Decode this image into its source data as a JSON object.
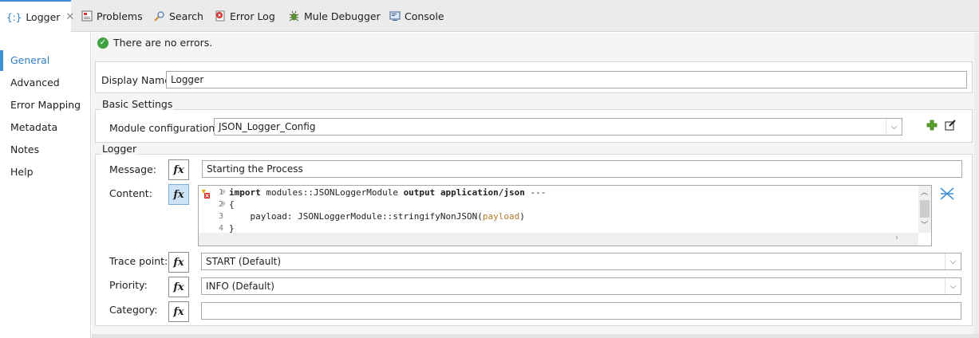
{
  "tabs": [
    {
      "label": "Logger",
      "icon": "logger-icon"
    },
    {
      "label": "Problems",
      "icon": "problems-icon"
    },
    {
      "label": "Search",
      "icon": "search-icon"
    },
    {
      "label": "Error Log",
      "icon": "error-log-icon"
    },
    {
      "label": "Mule Debugger",
      "icon": "debugger-icon"
    },
    {
      "label": "Console",
      "icon": "console-icon"
    }
  ],
  "logger_tab_glyph": "{:}",
  "sidebar": {
    "items": [
      {
        "label": "General",
        "active": true
      },
      {
        "label": "Advanced"
      },
      {
        "label": "Error Mapping"
      },
      {
        "label": "Metadata"
      },
      {
        "label": "Notes"
      },
      {
        "label": "Help"
      }
    ]
  },
  "status": {
    "text": "There are no errors."
  },
  "display_name": {
    "label": "Display Name:",
    "value": "Logger"
  },
  "basic_settings": {
    "title": "Basic Settings",
    "module_label": "Module configuration:",
    "module_value": "JSON_Logger_Config"
  },
  "logger": {
    "title": "Logger",
    "message_label": "Message:",
    "message_value": "Starting the Process",
    "content_label": "Content:",
    "content_lines": [
      {
        "num": "1",
        "fold": "⊖"
      },
      {
        "num": "2",
        "fold": "⊖"
      },
      {
        "num": "3",
        "fold": ""
      },
      {
        "num": "4",
        "fold": ""
      }
    ],
    "code": {
      "l1_kw1": "import",
      "l1_mid": " modules::JSONLoggerModule ",
      "l1_kw2": "output",
      "l1_kw3": "application/json",
      "l1_end": " ---",
      "l2": "{",
      "l3_pre": "    payload: JSONLoggerModule::stringifyNonJSON(",
      "l3_var": "payload",
      "l3_post": ")",
      "l4": "}"
    },
    "trace_label": "Trace point:",
    "trace_value": "START (Default)",
    "priority_label": "Priority:",
    "priority_value": "INFO (Default)",
    "category_label": "Category:",
    "category_value": ""
  },
  "fx_text": "fx",
  "colors": {
    "accent": "#3f8fd6",
    "ok": "#3fa13f",
    "add": "#5aa02c"
  }
}
